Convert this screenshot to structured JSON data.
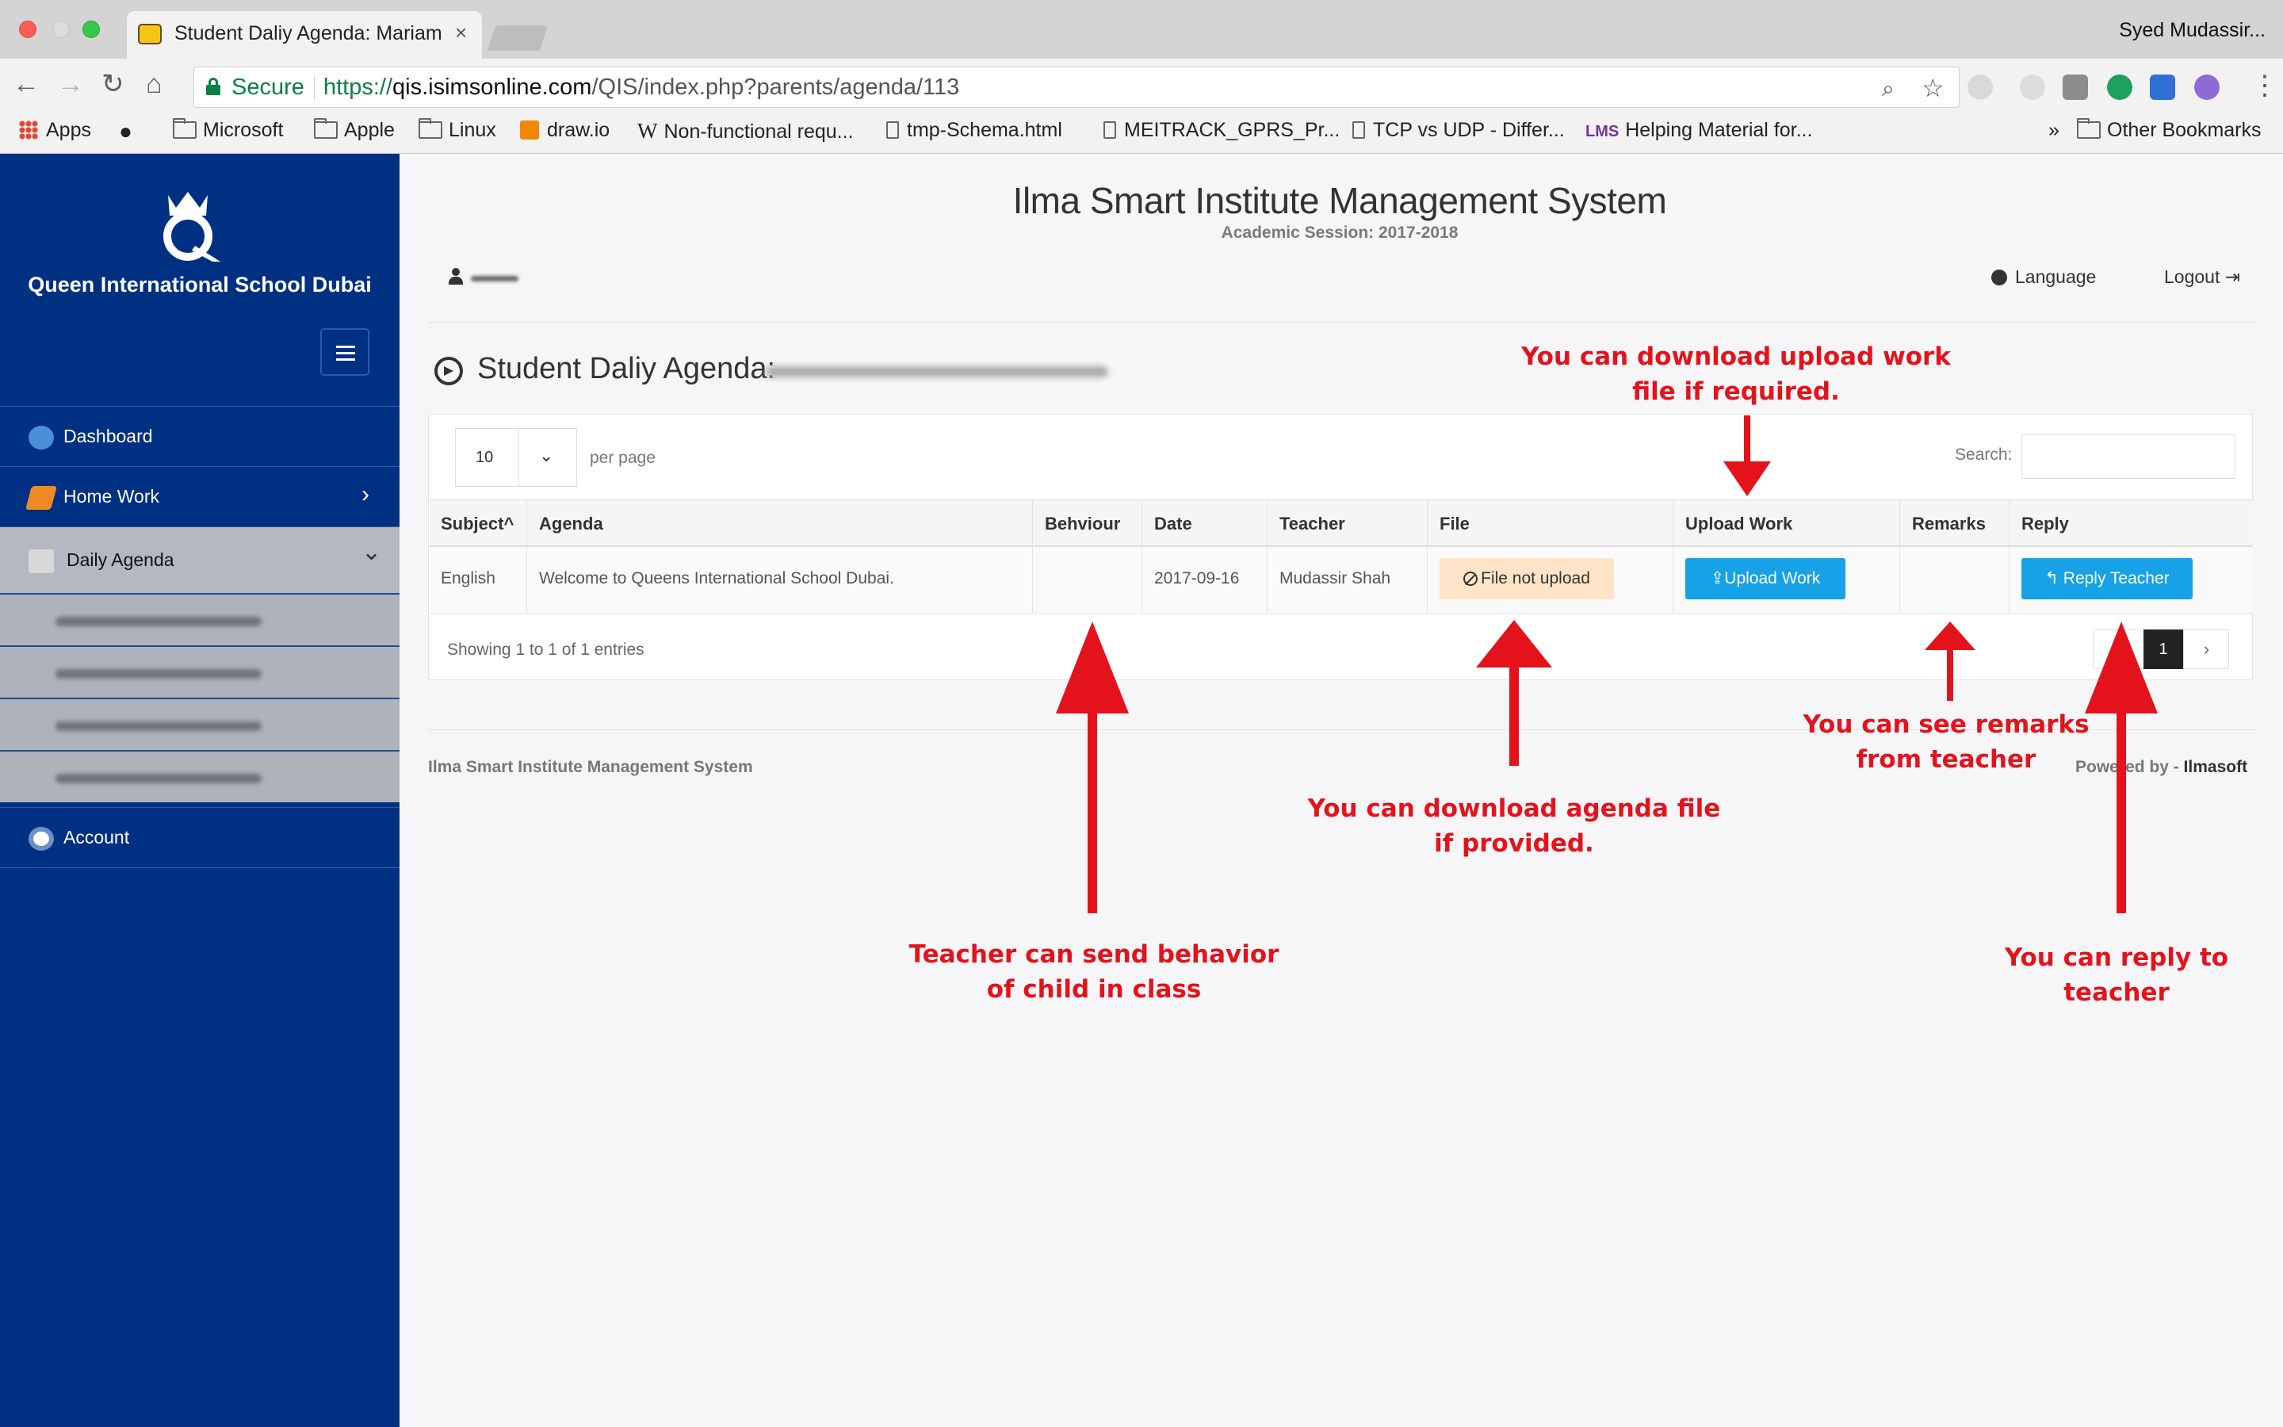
{
  "browser": {
    "tab_title": "Student Daliy Agenda: Mariam",
    "tab_close": "×",
    "profile_name": "Syed Mudassir...",
    "secure_label": "Secure",
    "url_scheme": "https://",
    "url_host": "qis.isimsonline.com",
    "url_path": "/QIS/index.php?parents/agenda/113",
    "bookmarks": [
      {
        "label": "Apps",
        "icon": "apps-grid-icon"
      },
      {
        "label": "",
        "icon": "apple-logo-icon"
      },
      {
        "label": "Microsoft",
        "icon": "folder-icon"
      },
      {
        "label": "Apple",
        "icon": "folder-icon"
      },
      {
        "label": "Linux",
        "icon": "folder-icon"
      },
      {
        "label": "draw.io",
        "icon": "drawio-icon"
      },
      {
        "label": "Non-functional requ...",
        "icon": "wikipedia-icon"
      },
      {
        "label": "tmp-Schema.html",
        "icon": "page-icon"
      },
      {
        "label": "MEITRACK_GPRS_Pr...",
        "icon": "page-icon"
      },
      {
        "label": "TCP vs UDP - Differ...",
        "icon": "page-icon"
      },
      {
        "label": "Helping Material for...",
        "icon": "lms-icon"
      }
    ],
    "bookmarks_overflow": "»",
    "other_bookmarks": "Other Bookmarks"
  },
  "sidebar": {
    "school_name": "Queen International School Dubai",
    "items": [
      {
        "label": "Dashboard",
        "icon": "dashboard-globe-icon"
      },
      {
        "label": "Home Work",
        "icon": "book-icon",
        "arrow": "›"
      },
      {
        "label": "Daily Agenda",
        "icon": "megaphone-icon",
        "arrow": "⌄"
      },
      {
        "label": "Account",
        "icon": "account-icon"
      }
    ]
  },
  "header": {
    "app_title": "Ilma Smart Institute Management System",
    "session": "Academic Session: 2017-2018",
    "language": "Language",
    "logout": "Logout"
  },
  "page": {
    "heading": "Student Daliy Agenda:"
  },
  "table": {
    "page_size": "10",
    "per_page": "per page",
    "search_label": "Search:",
    "columns": [
      "Subject",
      "Agenda",
      "Behviour",
      "Date",
      "Teacher",
      "File",
      "Upload Work",
      "Remarks",
      "Reply"
    ],
    "sort_indicator": "^",
    "rows": [
      {
        "subject": "English",
        "agenda": "Welcome to Queens International School Dubai.",
        "behaviour": "",
        "date": "2017-09-16",
        "teacher": "Mudassir Shah",
        "file": "File not upload",
        "upload_work": "Upload Work",
        "remarks": "",
        "reply": "Reply Teacher"
      }
    ],
    "showing": "Showing 1 to 1 of 1 entries",
    "current_page": "1",
    "next": "›"
  },
  "footer": {
    "left": "Ilma Smart Institute Management System",
    "powered_by": "Powered by -",
    "company": "Ilmasoft"
  },
  "annotations": {
    "upload_line1": "You can download upload work",
    "upload_line2": "file if required.",
    "file_line1": "You can download agenda file",
    "file_line2": "if provided.",
    "behaviour_line1": "Teacher can send behavior",
    "behaviour_line2": "of child in class",
    "remarks_line1": "You can see remarks",
    "remarks_line2": "from teacher",
    "reply_line1": "You can reply to teacher"
  },
  "colors": {
    "sidebar": "#003082",
    "accent": "#17a1e6",
    "annotation": "#e4131b",
    "file_badge": "#fde4c6"
  }
}
